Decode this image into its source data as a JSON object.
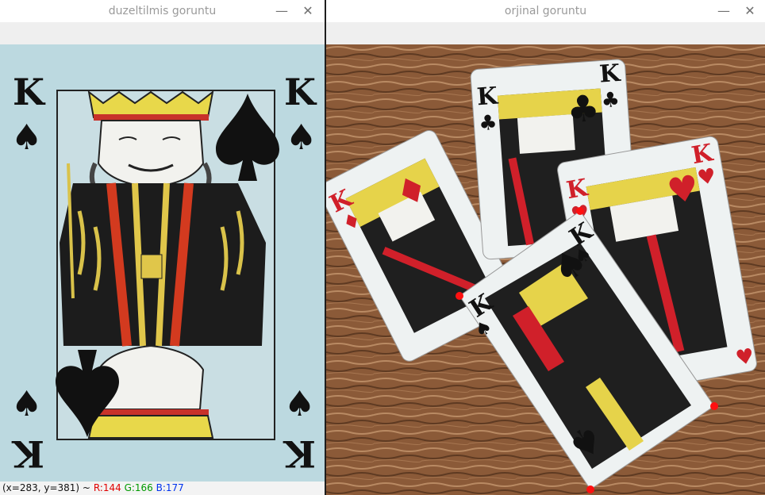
{
  "left_window": {
    "title": "duzeltilmis goruntu",
    "image": {
      "description": "",
      "card_rank": "K",
      "card_suit_symbol": "♠",
      "background": "#bcd9e0"
    },
    "status": {
      "coords": "(x=283, y=381) ~",
      "r": "R:144",
      "g": "G:166",
      "b": "B:177"
    }
  },
  "right_window": {
    "title": "orjinal goruntu",
    "image": {
      "cards": [
        {
          "rank": "K",
          "suit": "♦",
          "color": "#d0202a"
        },
        {
          "rank": "K",
          "suit": "♣",
          "color": "#111111"
        },
        {
          "rank": "K",
          "suit": "♥",
          "color": "#d0202a"
        },
        {
          "rank": "K",
          "suit": "♠",
          "color": "#111111"
        }
      ],
      "table_color": "#8a5a3a"
    }
  },
  "controls": {
    "minimize": "—",
    "close": "✕"
  },
  "colors": {
    "marker": "#ff1010"
  }
}
